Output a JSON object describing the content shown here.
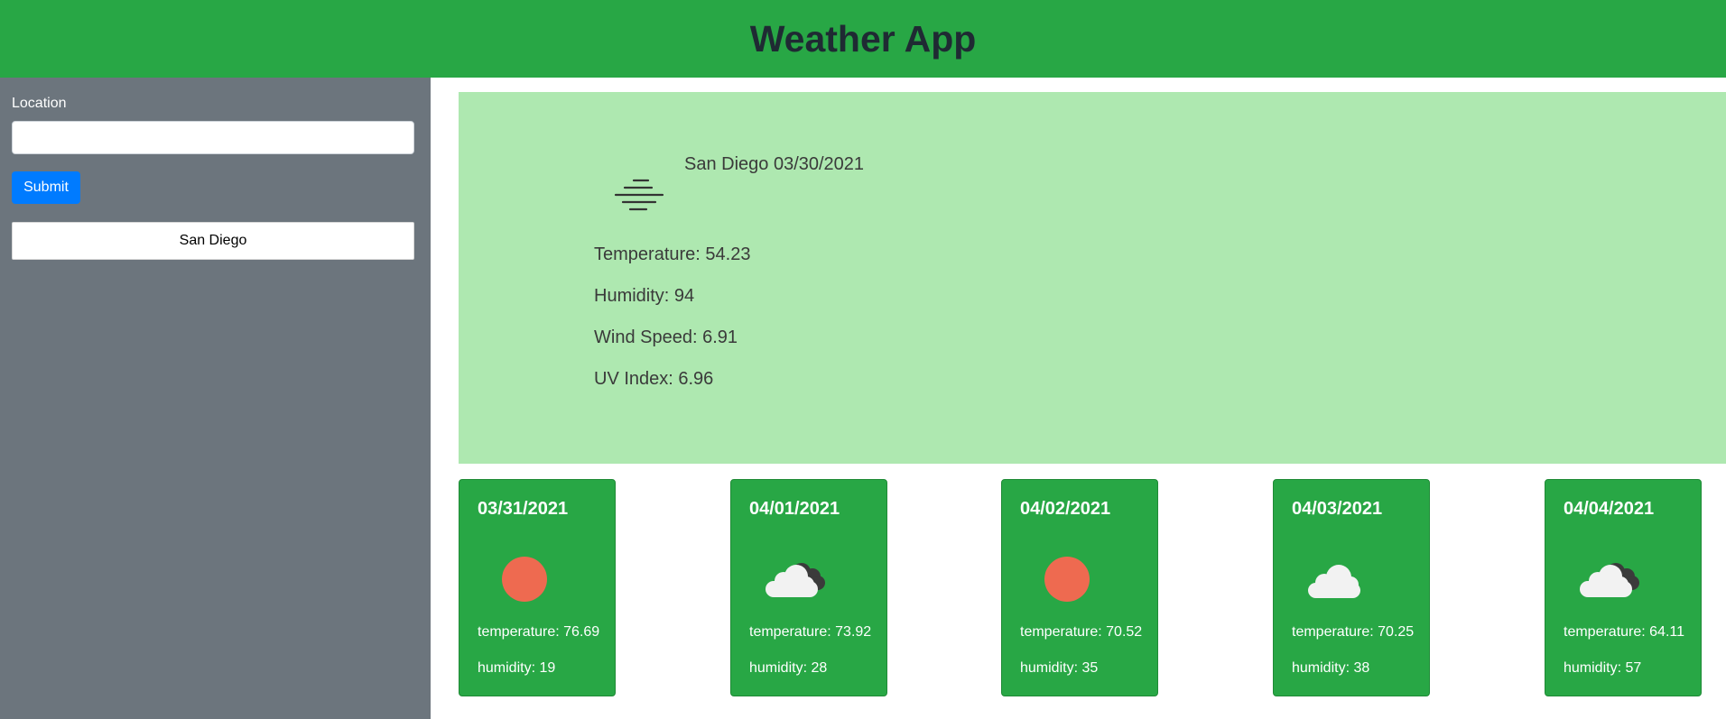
{
  "header": {
    "title": "Weather App"
  },
  "sidebar": {
    "location_label": "Location",
    "location_value": "",
    "submit_label": "Submit",
    "history": [
      "San Diego"
    ]
  },
  "current": {
    "title": "San Diego 03/30/2021",
    "icon": "mist-icon",
    "temperature": "Temperature: 54.23",
    "humidity": "Humidity: 94",
    "wind": "Wind Speed: 6.91",
    "uv": "UV Index: 6.96"
  },
  "forecast": [
    {
      "date": "03/31/2021",
      "icon": "sun-icon",
      "temp": "temperature: 76.69",
      "humidity": "humidity: 19"
    },
    {
      "date": "04/01/2021",
      "icon": "broken-clouds-icon",
      "temp": "temperature: 73.92",
      "humidity": "humidity: 28"
    },
    {
      "date": "04/02/2021",
      "icon": "sun-icon",
      "temp": "temperature: 70.52",
      "humidity": "humidity: 35"
    },
    {
      "date": "04/03/2021",
      "icon": "cloud-icon",
      "temp": "temperature: 70.25",
      "humidity": "humidity: 38"
    },
    {
      "date": "04/04/2021",
      "icon": "broken-clouds-icon",
      "temp": "temperature: 64.11",
      "humidity": "humidity: 57"
    }
  ],
  "colors": {
    "header": "#28a745",
    "sidebar": "#6c757d",
    "current_bg": "#aee8b0",
    "submit": "#007bff",
    "sun": "#ee6a50"
  }
}
